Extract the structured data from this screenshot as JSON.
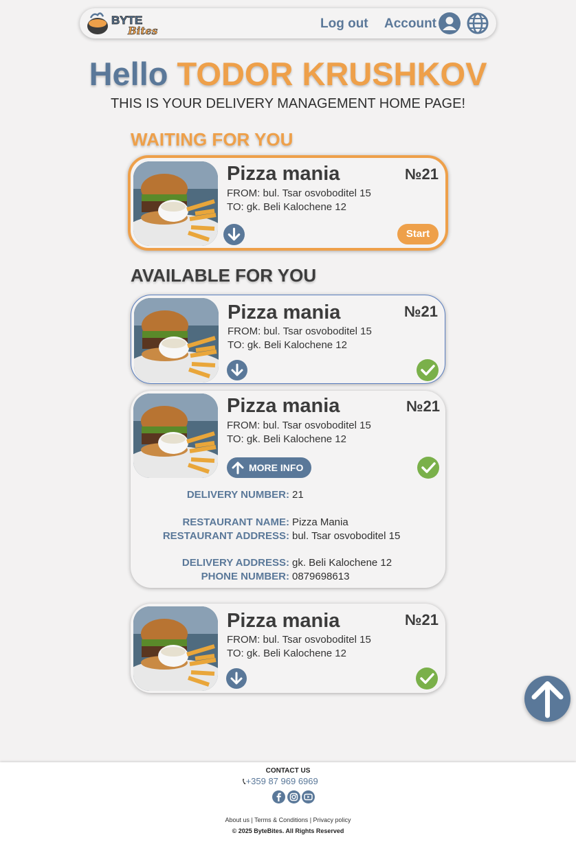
{
  "header": {
    "logo_text": "ByteBites",
    "logout_label": "Log out",
    "account_label": "Account"
  },
  "greeting": {
    "hello": "Hello",
    "name": "TODOR KRUSHKOV",
    "subtitle": "THIS IS YOUR DELIVERY MANAGEMENT HOME PAGE!"
  },
  "sections": {
    "waiting_title": "WAITING FOR YOU",
    "available_title": "AVAILABLE FOR YOU"
  },
  "waiting_order": {
    "restaurant": "Pizza mania",
    "number": "№21",
    "from": "FROM: bul. Tsar osvoboditel 15",
    "to": "TO: gk. Beli Kalochene 12",
    "start_label": "Start"
  },
  "available_orders": [
    {
      "restaurant": "Pizza mania",
      "number": "№21",
      "from": "FROM: bul. Tsar osvoboditel 15",
      "to": "TO: gk. Beli Kalochene 12"
    },
    {
      "restaurant": "Pizza mania",
      "number": "№21",
      "from": "FROM: bul. Tsar osvoboditel 15",
      "to": "TO: gk. Beli Kalochene 12",
      "more_info_label": "MORE INFO",
      "details": {
        "delivery_number_label": "DELIVERY NUMBER:",
        "delivery_number": "21",
        "restaurant_name_label": "RESTAURANT NAME:",
        "restaurant_name": "Pizza Mania",
        "restaurant_address_label": "RESTAURANT ADDRESS:",
        "restaurant_address": "bul. Tsar osvoboditel 15",
        "delivery_address_label": "DELIVERY ADDRESS:",
        "delivery_address": "gk. Beli Kalochene 12",
        "phone_label": "PHONE NUMBER:",
        "phone": "0879698613"
      }
    },
    {
      "restaurant": "Pizza mania",
      "number": "№21",
      "from": "FROM: bul. Tsar osvoboditel 15",
      "to": "TO: gk. Beli Kalochene 12"
    }
  ],
  "footer": {
    "contact_title": "CONTACT US",
    "phone": "+359 87 969 6969",
    "about": "About us",
    "terms": "Terms & Conditions",
    "privacy": "Privacy policy",
    "copyright": "© 2025 ByteBites. All Rights Reserved"
  },
  "colors": {
    "accent_orange": "#eea04a",
    "accent_blue": "#5a7899",
    "confirm_green": "#7ab04a",
    "background": "#f3f2f2"
  },
  "icons": [
    "logo-icon",
    "user-icon",
    "globe-icon",
    "arrow-down-icon",
    "arrow-up-icon",
    "check-icon",
    "scroll-top-icon",
    "phone-icon",
    "facebook-icon",
    "instagram-icon",
    "youtube-icon"
  ]
}
